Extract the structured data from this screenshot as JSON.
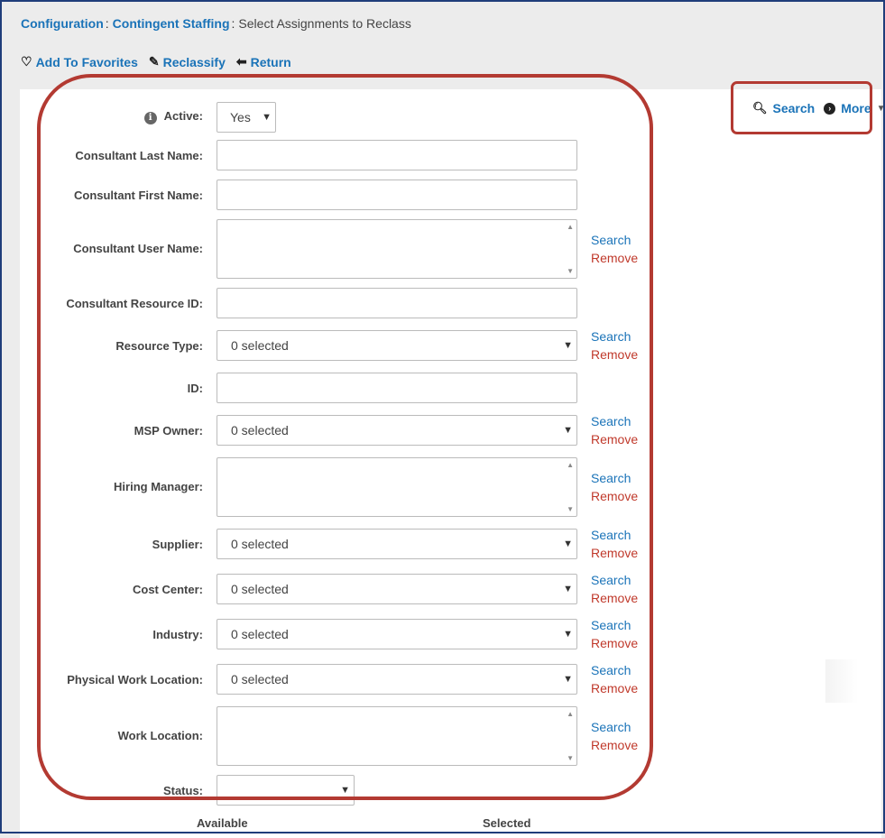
{
  "breadcrumb": {
    "items": [
      "Configuration",
      "Contingent Staffing"
    ],
    "current": "Select Assignments to Reclass"
  },
  "actions": {
    "favorites": "Add To Favorites",
    "reclassify": "Reclassify",
    "return": "Return"
  },
  "toolbar": {
    "search": "Search",
    "more": "More"
  },
  "form": {
    "active_label": "Active:",
    "active_value": "Yes",
    "last_name_label": "Consultant Last Name:",
    "first_name_label": "Consultant First Name:",
    "user_name_label": "Consultant User Name:",
    "resource_id_label": "Consultant Resource ID:",
    "resource_type_label": "Resource Type:",
    "id_label": "ID:",
    "msp_owner_label": "MSP Owner:",
    "hiring_manager_label": "Hiring Manager:",
    "supplier_label": "Supplier:",
    "cost_center_label": "Cost Center:",
    "industry_label": "Industry:",
    "physical_location_label": "Physical Work Location:",
    "work_location_label": "Work Location:",
    "status_label": "Status:",
    "selected_text": "0 selected",
    "search_link": "Search",
    "remove_link": "Remove",
    "available_label": "Available",
    "selected_label": "Selected"
  }
}
